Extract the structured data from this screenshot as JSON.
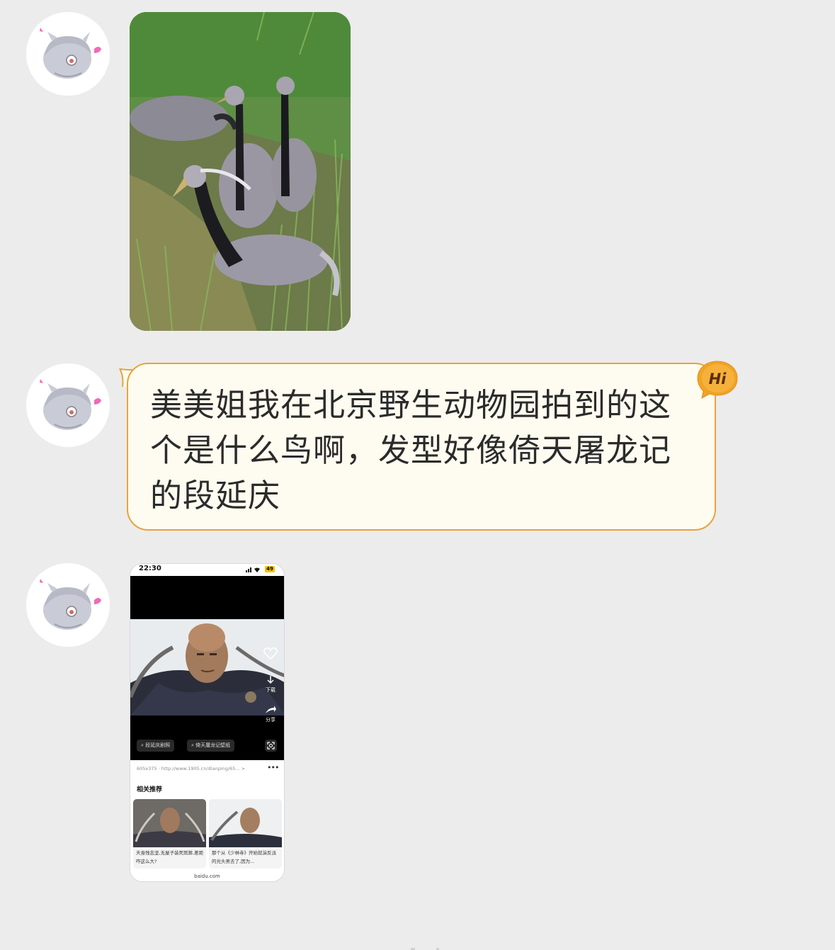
{
  "messages": [
    {
      "type": "image",
      "alt": ""
    },
    {
      "type": "text",
      "text": "美美姐我在北京野生动物园拍到的这个是什么鸟啊，发型好像倚天屠龙记的段延庆",
      "badge": "Hi"
    },
    {
      "type": "screenshot",
      "status_time": "22:30",
      "battery": "49",
      "side_actions": {
        "download": "下载",
        "share": "分享"
      },
      "search_tags": [
        "段延庆剧照",
        "倚天屠龙记壁纸"
      ],
      "source_line": "605x375 · http://www.1905.cn/dianping/65...  >",
      "related_title": "相关推荐",
      "related_cards": [
        {
          "caption": "天身残志坚,无屋子装死殡葬,差距咋这么大?"
        },
        {
          "caption": "那个从《少林寺》开始就演反派的光头男去了,因为..."
        }
      ],
      "domain": "baidu.com"
    }
  ],
  "colors": {
    "background": "#ececec",
    "bubble_fill": "#fefcf0",
    "bubble_border": "#e9a23b",
    "badge": "#f0a326"
  }
}
